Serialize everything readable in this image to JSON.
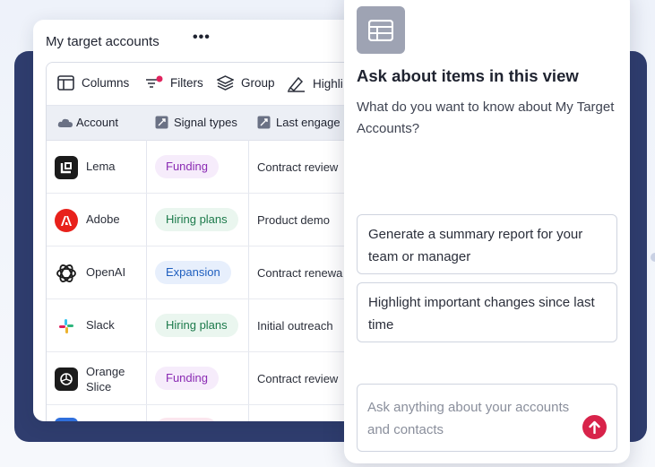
{
  "card": {
    "title": "My target accounts",
    "more": "•••"
  },
  "toolbar": {
    "columns": "Columns",
    "filters": "Filters",
    "group": "Group",
    "highlight": "Highli"
  },
  "table": {
    "headers": [
      "Account",
      "Signal types",
      "Last engage"
    ],
    "rows": [
      {
        "account": "Lema",
        "signal": "Funding",
        "engagement": "Contract review"
      },
      {
        "account": "Adobe",
        "signal": "Hiring plans",
        "engagement": "Product demo"
      },
      {
        "account": "OpenAI",
        "signal": "Expansion",
        "engagement": "Contract renewa"
      },
      {
        "account": "Slack",
        "signal": "Hiring plans",
        "engagement": "Initial outreach"
      },
      {
        "account": "Orange Slice",
        "signal": "Funding",
        "engagement": "Contract review"
      }
    ]
  },
  "panel": {
    "title": "Ask about items in this view",
    "subtitle": "What do you want to know about My Target Accounts?",
    "suggestions": [
      "Generate a summary report for your team or manager",
      "Highlight important changes since last time"
    ],
    "input_placeholder": "Ask anything about your accounts and contacts"
  },
  "colors": {
    "navy": "#2f3d6e",
    "send_button": "#d8234a",
    "filter_dot": "#e0245e"
  }
}
